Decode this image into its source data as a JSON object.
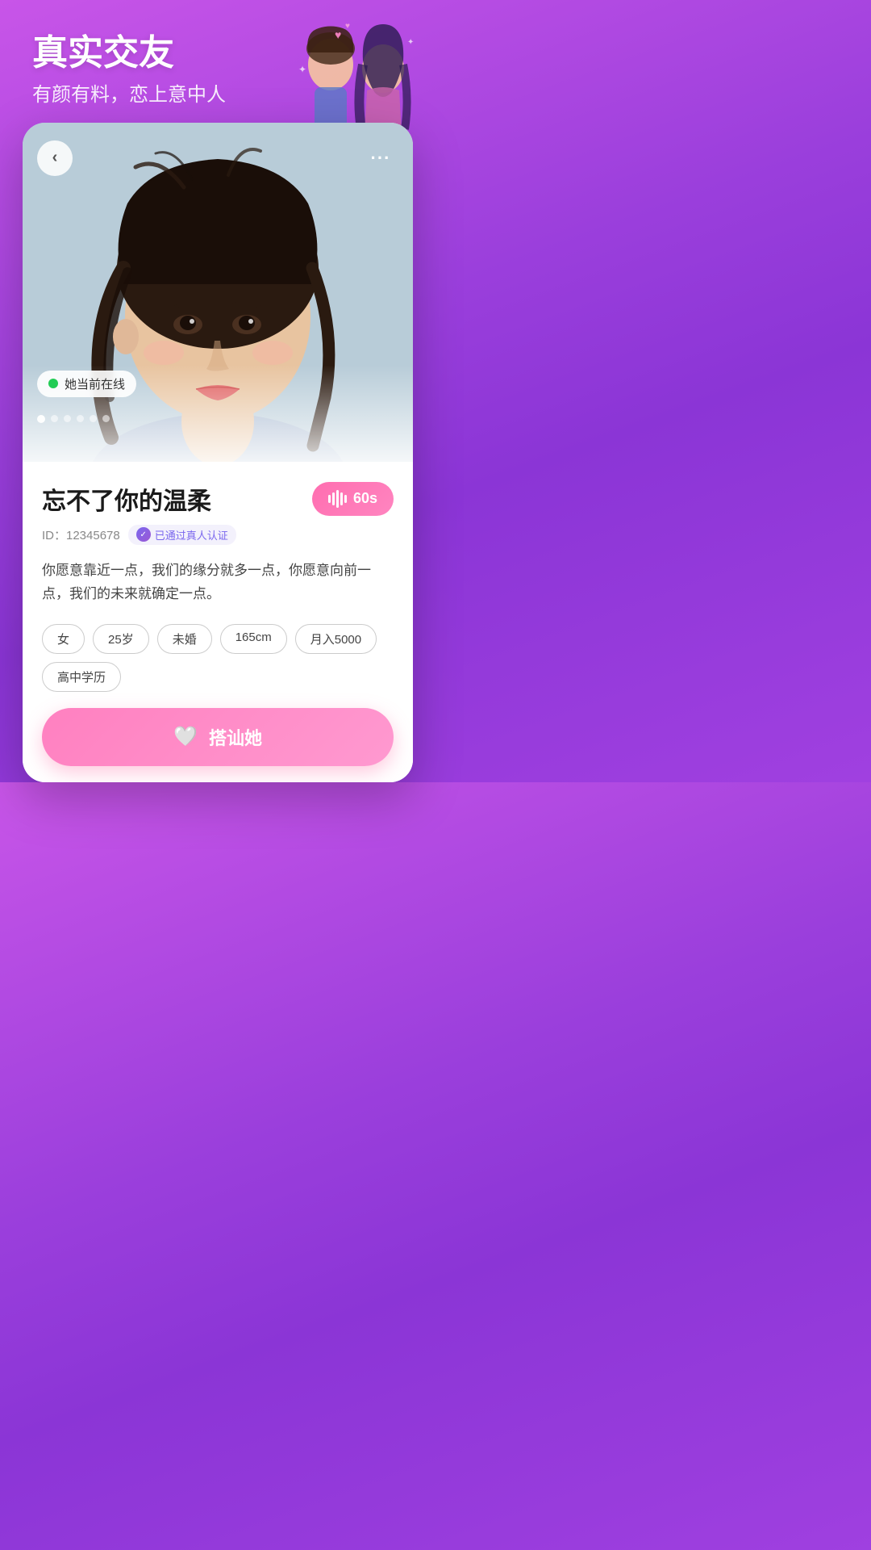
{
  "header": {
    "title": "真实交友",
    "subtitle": "有颜有料，恋上意中人"
  },
  "card": {
    "back_button_label": "‹",
    "more_button_label": "···",
    "online_status": "她当前在线",
    "photo_dots": [
      1,
      2,
      3,
      4,
      5,
      6
    ],
    "active_dot": 1,
    "profile_name": "忘不了你的温柔",
    "voice_button_label": "60s",
    "id_text": "ID：12345678",
    "verified_text": "已通过真人认证",
    "bio": "你愿意靠近一点，我们的缘分就多一点，你愿意向前一点，我们的未来就确定一点。",
    "tags": [
      "女",
      "25岁",
      "未婚",
      "165cm",
      "月入5000",
      "高中学历"
    ],
    "action_button_label": "搭讪她"
  },
  "colors": {
    "bg_gradient_start": "#c855e8",
    "bg_gradient_end": "#8b35d6",
    "accent_pink": "#ff6eb0",
    "online_green": "#22cc55",
    "verified_purple": "#7b68ee"
  }
}
